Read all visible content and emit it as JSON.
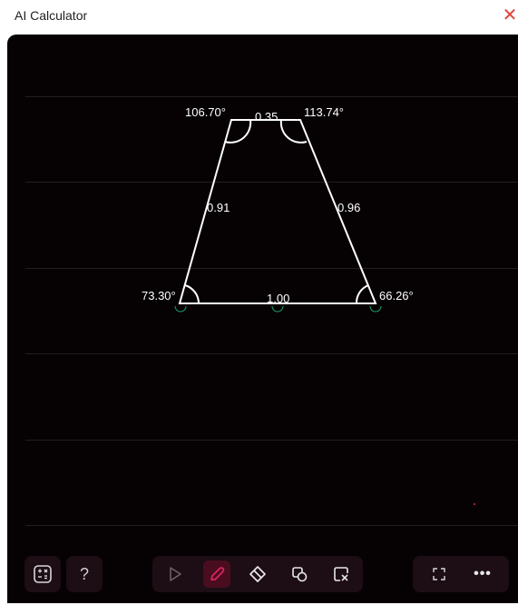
{
  "window": {
    "title": "AI Calculator",
    "close_glyph": "✕"
  },
  "figure": {
    "angles": {
      "top_left": "106.70°",
      "top_right": "113.74°",
      "bottom_left": "73.30°",
      "bottom_right": "66.26°"
    },
    "sides": {
      "top": "0.35",
      "left": "0.91",
      "right": "0.96",
      "bottom": "1.00"
    },
    "stroke_color": "#ffffff",
    "marker_color": "#1e9e6a"
  },
  "toolbar": {
    "help_label": "?",
    "more_label": "•••",
    "icons": [
      "calculator-icon",
      "help-icon",
      "select-icon",
      "pen-icon",
      "eraser-icon",
      "shapes-icon",
      "clear-icon",
      "fullscreen-icon",
      "more-icon"
    ],
    "accent_color": "#e0245e"
  },
  "colors": {
    "background": "#060204",
    "button_bg": "#1d0d14",
    "active_bg": "#4a0d20"
  }
}
